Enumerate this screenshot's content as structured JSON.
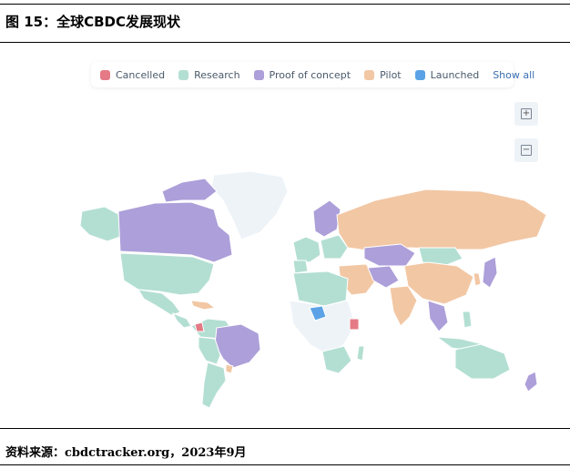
{
  "figure": {
    "title": "图 15：全球CBDC发展现状",
    "source": "资料来源：cbdctracker.org，2023年9月"
  },
  "legend": {
    "items": [
      {
        "label": "Cancelled",
        "color": "#e57a86"
      },
      {
        "label": "Research",
        "color": "#b3dfd2"
      },
      {
        "label": "Proof of concept",
        "color": "#ad9fd9"
      },
      {
        "label": "Pilot",
        "color": "#f2c7a4"
      },
      {
        "label": "Launched",
        "color": "#5ba3e6"
      }
    ],
    "show_all": "Show all"
  },
  "zoom": {
    "in_icon": "plus-icon",
    "out_icon": "minus-icon"
  },
  "colors": {
    "no_data": "#eef3f8",
    "border": "#ffffff"
  }
}
